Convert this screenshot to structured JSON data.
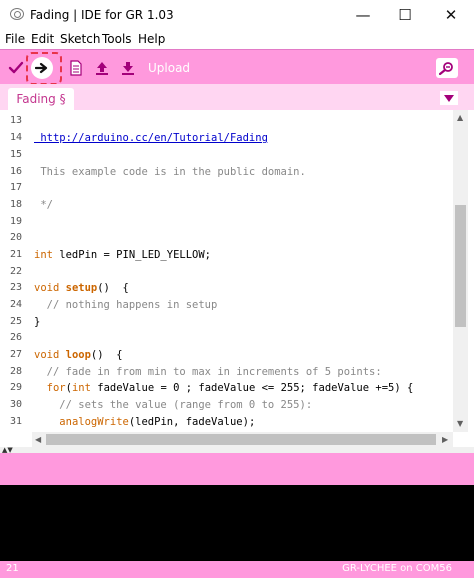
{
  "window": {
    "title": "Fading | IDE for GR 1.03",
    "minimize_glyph": "—",
    "maximize_glyph": "☐",
    "close_glyph": "✕"
  },
  "menu": [
    "File",
    "Edit",
    "Sketch",
    "Tools",
    "Help"
  ],
  "toolbar": {
    "hover_label": "Upload",
    "icons": [
      "check-icon",
      "right-arrow-icon",
      "document-icon",
      "up-arrow-icon",
      "down-arrow-icon",
      "magnifier-icon"
    ]
  },
  "tab": {
    "label": "Fading §",
    "menu_glyph": "▼"
  },
  "editor": {
    "line_numbers": [
      "13",
      "14",
      "15",
      "16",
      "17",
      "18",
      "19",
      "20",
      "21",
      "22",
      "23",
      "24",
      "25",
      "26",
      "27",
      "28",
      "29",
      "30",
      "31"
    ],
    "lines": [
      "",
      " http://arduino.cc/en/Tutorial/Fading",
      "",
      " This example code is in the public domain.",
      "",
      " */",
      "",
      "",
      "int ledPin = PIN_LED_YELLOW;",
      "",
      "void setup()  {",
      "  // nothing happens in setup",
      "}",
      "",
      "void loop()  {",
      "  // fade in from min to max in increments of 5 points:",
      "  for(int fadeValue = 0 ; fadeValue <= 255; fadeValue +=5) {",
      "    // sets the value (range from 0 to 255):",
      "    analogWrite(ledPin, fadeValue);"
    ]
  },
  "status": {
    "line": "21",
    "board": "GR-LYCHEE on COM56"
  },
  "colors": {
    "accent": "#ff99dd",
    "tab_bg": "#ffd6f2",
    "tab_text": "#c4378f",
    "highlight": "#e8334a",
    "keyword": "#cc6600",
    "comment": "#888888",
    "link": "#0000cc"
  }
}
